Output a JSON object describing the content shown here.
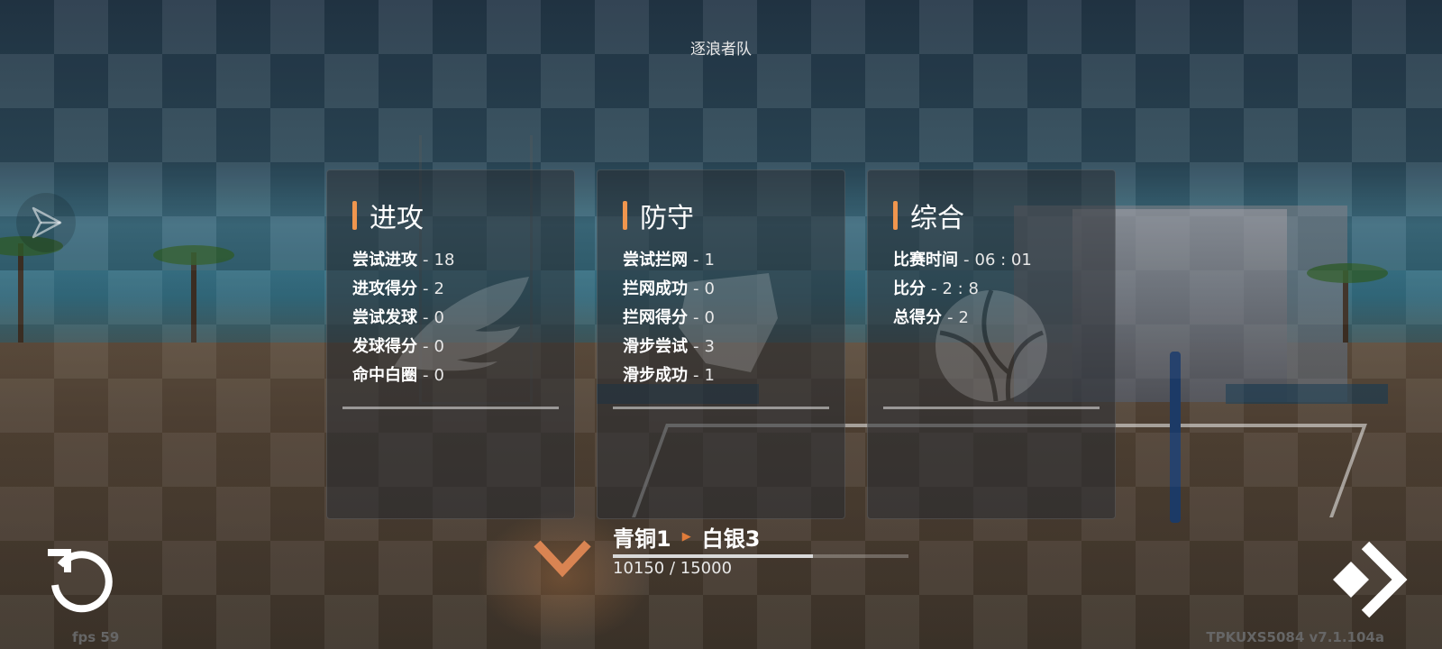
{
  "header": {
    "team_name": "逐浪者队"
  },
  "panels": [
    {
      "title": "进攻",
      "stats": [
        {
          "label": "尝试进攻",
          "value": "18"
        },
        {
          "label": "进攻得分",
          "value": "2"
        },
        {
          "label": "尝试发球",
          "value": "0"
        },
        {
          "label": "发球得分",
          "value": "0"
        },
        {
          "label": "命中白圈",
          "value": "0"
        }
      ],
      "emblem": "wing-icon"
    },
    {
      "title": "防守",
      "stats": [
        {
          "label": "尝试拦网",
          "value": "1"
        },
        {
          "label": "拦网成功",
          "value": "0"
        },
        {
          "label": "拦网得分",
          "value": "0"
        },
        {
          "label": "滑步尝试",
          "value": "3"
        },
        {
          "label": "滑步成功",
          "value": "1"
        }
      ],
      "emblem": "shield-icon"
    },
    {
      "title": "综合",
      "stats": [
        {
          "label": "比赛时间",
          "value": "06 : 01"
        },
        {
          "label": "比分",
          "value": "2 : 8"
        },
        {
          "label": "总得分",
          "value": "2"
        }
      ],
      "emblem": "volleyball-icon"
    }
  ],
  "stat_separator": "-",
  "rank": {
    "from": "青铜1",
    "to": "白银3",
    "arrow": "▶",
    "xp_text": "10150 / 15000",
    "progress": 0.6767
  },
  "footer": {
    "fps": "fps 59",
    "version": "TPKUXS5084   v7.1.104a"
  },
  "colors": {
    "accent": "#f0964e",
    "rank_arrow": "#e07c3a"
  }
}
